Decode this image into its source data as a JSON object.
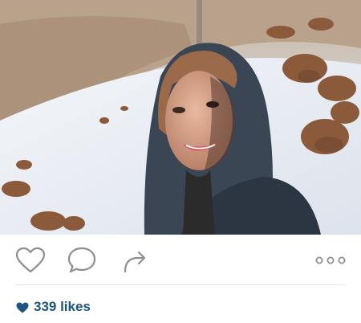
{
  "post": {
    "photo": {
      "subject_icon": "selfie-photo",
      "palette": {
        "sky": "#cfd8e3",
        "snow": "#eef1f6",
        "rock": "#8a5a3a",
        "scarf": "#3b4654",
        "skin": "#d9a489",
        "hair": "#9b6a4a"
      }
    },
    "actions": {
      "like_icon": "heart-outline-icon",
      "comment_icon": "comment-bubble-icon",
      "share_icon": "share-arrow-icon",
      "more_icon": "more-options-icon",
      "icon_color": "#8f8f8f"
    },
    "likes": {
      "icon": "heart-filled-icon",
      "label": "339 likes",
      "color": "#1d5583"
    }
  }
}
